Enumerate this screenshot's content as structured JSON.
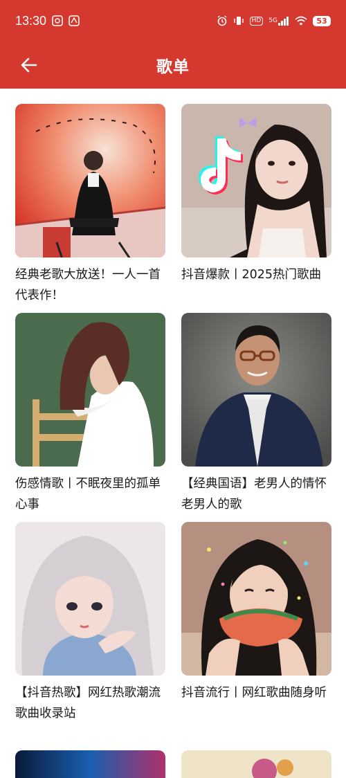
{
  "status_bar": {
    "time": "13:30",
    "network_label": "5G",
    "hd_label": "HD",
    "battery": "53"
  },
  "app_bar": {
    "title": "歌单",
    "back_icon": "arrow-left-icon"
  },
  "colors": {
    "header": "#d4382f",
    "background": "#ffffff",
    "text": "#1a1a1a"
  },
  "playlists": [
    {
      "title": "经典老歌大放送！一人一首代表作！"
    },
    {
      "title": "抖音爆款丨2025热门歌曲"
    },
    {
      "title": "伤感情歌丨不眠夜里的孤单心事"
    },
    {
      "title": "【经典国语】老男人的情怀老男人的歌"
    },
    {
      "title": "【抖音热歌】网红热歌潮流歌曲收录站"
    },
    {
      "title": "抖音流行丨网红歌曲随身听"
    }
  ]
}
